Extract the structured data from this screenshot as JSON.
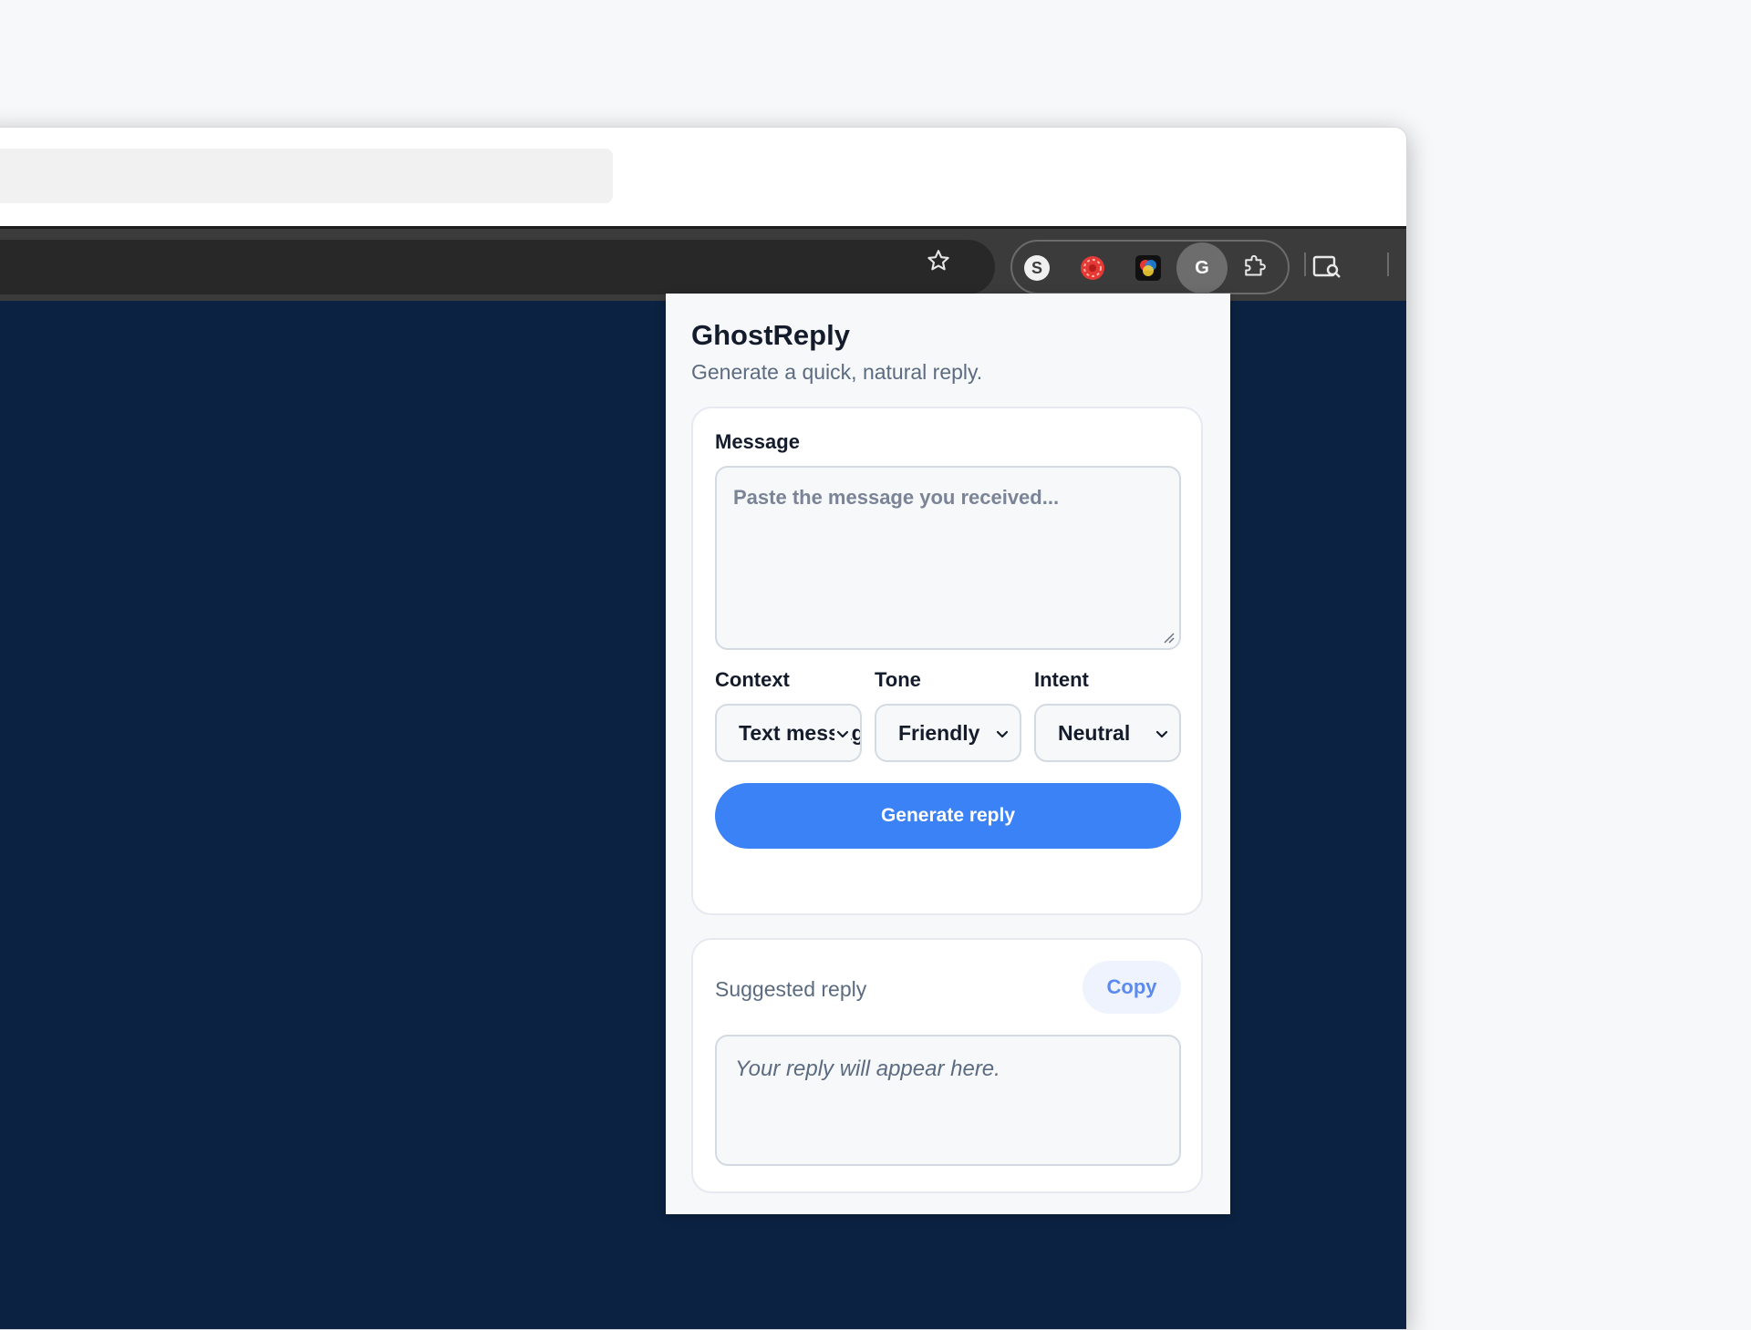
{
  "toolbar": {
    "extensions": [
      {
        "name": "s-extension"
      },
      {
        "name": "red-extension"
      },
      {
        "name": "color-extension"
      },
      {
        "name": "ghostreply-extension",
        "letter": "G"
      }
    ]
  },
  "popup": {
    "title": "GhostReply",
    "subtitle": "Generate a quick, natural reply.",
    "message": {
      "label": "Message",
      "placeholder": "Paste the message you received..."
    },
    "context": {
      "label": "Context",
      "value": "Text message"
    },
    "tone": {
      "label": "Tone",
      "value": "Friendly"
    },
    "intent": {
      "label": "Intent",
      "value": "Neutral"
    },
    "generate_label": "Generate reply",
    "suggested_label": "Suggested reply",
    "copy_label": "Copy",
    "reply_placeholder": "Your reply will appear here."
  },
  "colors": {
    "accent": "#3b82f6",
    "page_bg": "#0b2242",
    "toolbar": "#3b3b3b"
  }
}
